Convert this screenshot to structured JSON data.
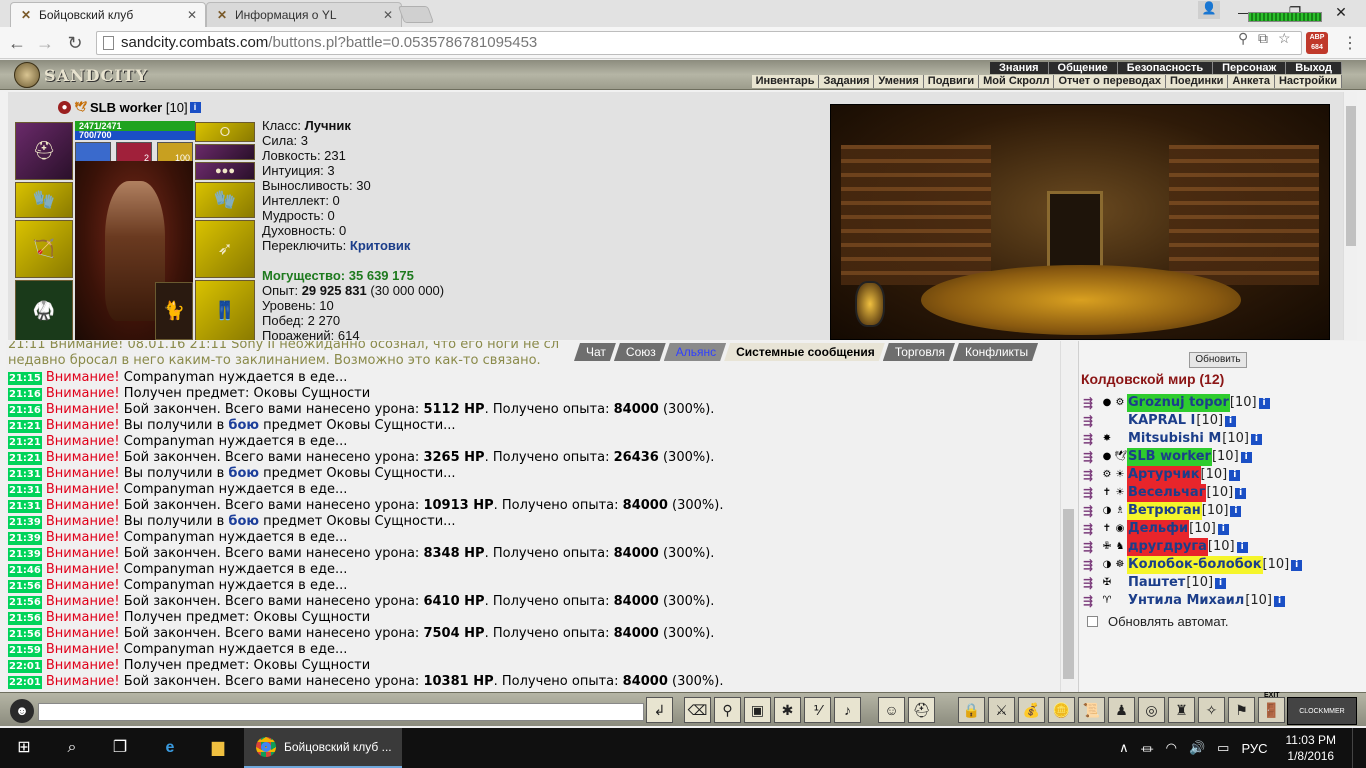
{
  "browser": {
    "tabs": [
      {
        "title": "Бойцовский клуб",
        "active": true
      },
      {
        "title": "Информация о YL",
        "active": false
      }
    ],
    "url_host": "sandcity.combats.com",
    "url_path": "/buttons.pl?battle=0.0535786781095453",
    "abp_count": "684"
  },
  "game": {
    "logo": "SANDCITY",
    "top_menu": [
      "Знания",
      "Общение",
      "Безопасность",
      "Персонаж",
      "Выход"
    ],
    "sub_menu": [
      "Инвентарь",
      "Задания",
      "Умения",
      "Подвиги",
      "Мой Скролл",
      "Отчет о переводах",
      "Поединки",
      "Анкета",
      "Настройки"
    ],
    "character": {
      "name": "SLB worker",
      "level": "[10]",
      "hp": "2471/2471",
      "mana": "700/700",
      "buff_count_1": "2",
      "buff_count_2": "100"
    },
    "stats": {
      "class_label": "Класс:",
      "class_value": "Лучник",
      "str": "Сила: 3",
      "agi": "Ловкость: 231",
      "int": "Интуиция: 3",
      "end": "Выносливость: 30",
      "intel": "Интеллект: 0",
      "wis": "Мудрость: 0",
      "spirit": "Духовность: 0",
      "switch_label": "Переключить:",
      "switch_value": "Критовик",
      "power_label": "Могущество:",
      "power_value": "35 639 175",
      "exp_label": "Опыт:",
      "exp_value": "29 925 831",
      "exp_next": "(30 000 000)",
      "level": "Уровень: 10",
      "wins": "Побед: 2 270",
      "losses": "Поражений: 614"
    }
  },
  "chat": {
    "tabs": [
      "Чат",
      "Союз",
      "Альянс",
      "Системные сообщения",
      "Торговля",
      "Конфликты"
    ],
    "header_faded_1": "21:11 Внимание! 08.01.16 21:11 Sony II неожиданно осознал, что его ноги не сл",
    "header_faded_2": "недавно бросал в него каким-то заклинанием. Возможно это как-то связано.",
    "messages": [
      {
        "time": "21:15",
        "warn": "Внимание!",
        "text": "Companyman нуждается в еде..."
      },
      {
        "time": "21:16",
        "warn": "Внимание!",
        "text": "Получен предмет: Оковы Сущности"
      },
      {
        "time": "21:16",
        "warn": "Внимание!",
        "pre": "Бой закончен. Всего вами нанесено урона: ",
        "dmg": "5112 HP",
        "mid": ". Получено опыта: ",
        "exp": "84000",
        "post": " (300%)."
      },
      {
        "time": "21:21",
        "warn": "Внимание!",
        "pre": "Вы получили в ",
        "link": "бою",
        "post": " предмет Оковы Сущности..."
      },
      {
        "time": "21:21",
        "warn": "Внимание!",
        "text": "Companyman нуждается в еде..."
      },
      {
        "time": "21:21",
        "warn": "Внимание!",
        "pre": "Бой закончен. Всего вами нанесено урона: ",
        "dmg": "3265 HP",
        "mid": ". Получено опыта: ",
        "exp": "26436",
        "post": " (300%)."
      },
      {
        "time": "21:31",
        "warn": "Внимание!",
        "pre": "Вы получили в ",
        "link": "бою",
        "post": " предмет Оковы Сущности..."
      },
      {
        "time": "21:31",
        "warn": "Внимание!",
        "text": "Companyman нуждается в еде..."
      },
      {
        "time": "21:31",
        "warn": "Внимание!",
        "pre": "Бой закончен. Всего вами нанесено урона: ",
        "dmg": "10913 HP",
        "mid": ". Получено опыта: ",
        "exp": "84000",
        "post": " (300%)."
      },
      {
        "time": "21:39",
        "warn": "Внимание!",
        "pre": "Вы получили в ",
        "link": "бою",
        "post": " предмет Оковы Сущности..."
      },
      {
        "time": "21:39",
        "warn": "Внимание!",
        "text": "Companyman нуждается в еде..."
      },
      {
        "time": "21:39",
        "warn": "Внимание!",
        "pre": "Бой закончен. Всего вами нанесено урона: ",
        "dmg": "8348 HP",
        "mid": ". Получено опыта: ",
        "exp": "84000",
        "post": " (300%)."
      },
      {
        "time": "21:46",
        "warn": "Внимание!",
        "text": "Companyman нуждается в еде..."
      },
      {
        "time": "21:56",
        "warn": "Внимание!",
        "text": "Companyman нуждается в еде..."
      },
      {
        "time": "21:56",
        "warn": "Внимание!",
        "pre": "Бой закончен. Всего вами нанесено урона: ",
        "dmg": "6410 HP",
        "mid": ". Получено опыта: ",
        "exp": "84000",
        "post": " (300%)."
      },
      {
        "time": "21:56",
        "warn": "Внимание!",
        "text": "Получен предмет: Оковы Сущности"
      },
      {
        "time": "21:56",
        "warn": "Внимание!",
        "pre": "Бой закончен. Всего вами нанесено урона: ",
        "dmg": "7504 HP",
        "mid": ". Получено опыта: ",
        "exp": "84000",
        "post": " (300%)."
      },
      {
        "time": "21:59",
        "warn": "Внимание!",
        "text": "Companyman нуждается в еде..."
      },
      {
        "time": "22:01",
        "warn": "Внимание!",
        "text": "Получен предмет: Оковы Сущности"
      },
      {
        "time": "22:01",
        "warn": "Внимание!",
        "pre": "Бой закончен. Всего вами нанесено урона: ",
        "dmg": "10381 HP",
        "mid": ". Получено опыта: ",
        "exp": "84000",
        "post": " (300%)."
      }
    ]
  },
  "room": {
    "refresh_label": "Обновить",
    "title": "Колдовской мир (12)",
    "users": [
      {
        "name": "Groznuj topor",
        "level": "[10]",
        "hl": "#2ecc2e"
      },
      {
        "name": "KAPRAL I",
        "level": "[10]",
        "hl": ""
      },
      {
        "name": "Mitsubishi M",
        "level": "[10]",
        "hl": ""
      },
      {
        "name": "SLB worker",
        "level": "[10]",
        "hl": "#2ecc2e"
      },
      {
        "name": "Артурчик",
        "level": "[10]",
        "hl": "#e8252b"
      },
      {
        "name": "Весельчаг",
        "level": "[10]",
        "hl": "#e8252b"
      },
      {
        "name": "Ветрюган",
        "level": "[10]",
        "hl": "#f5f52a"
      },
      {
        "name": "Дельфи",
        "level": "[10]",
        "hl": "#e8252b"
      },
      {
        "name": "другдруга",
        "level": "[10]",
        "hl": "#e8252b"
      },
      {
        "name": "Колобок-болобок",
        "level": "[10]",
        "hl": "#f5f52a"
      },
      {
        "name": "Паштет",
        "level": "[10]",
        "hl": ""
      },
      {
        "name": "Унтила Михаил",
        "level": "[10]",
        "hl": ""
      }
    ],
    "auto_refresh_label": "Обновлять автомат."
  },
  "bottom": {
    "exit_label": "EXIT",
    "clock_label": "CLOCKMMER"
  },
  "taskbar": {
    "app_title": "Бойцовский клуб ...",
    "lang": "РУС",
    "time": "11:03 PM",
    "date": "1/8/2016"
  }
}
